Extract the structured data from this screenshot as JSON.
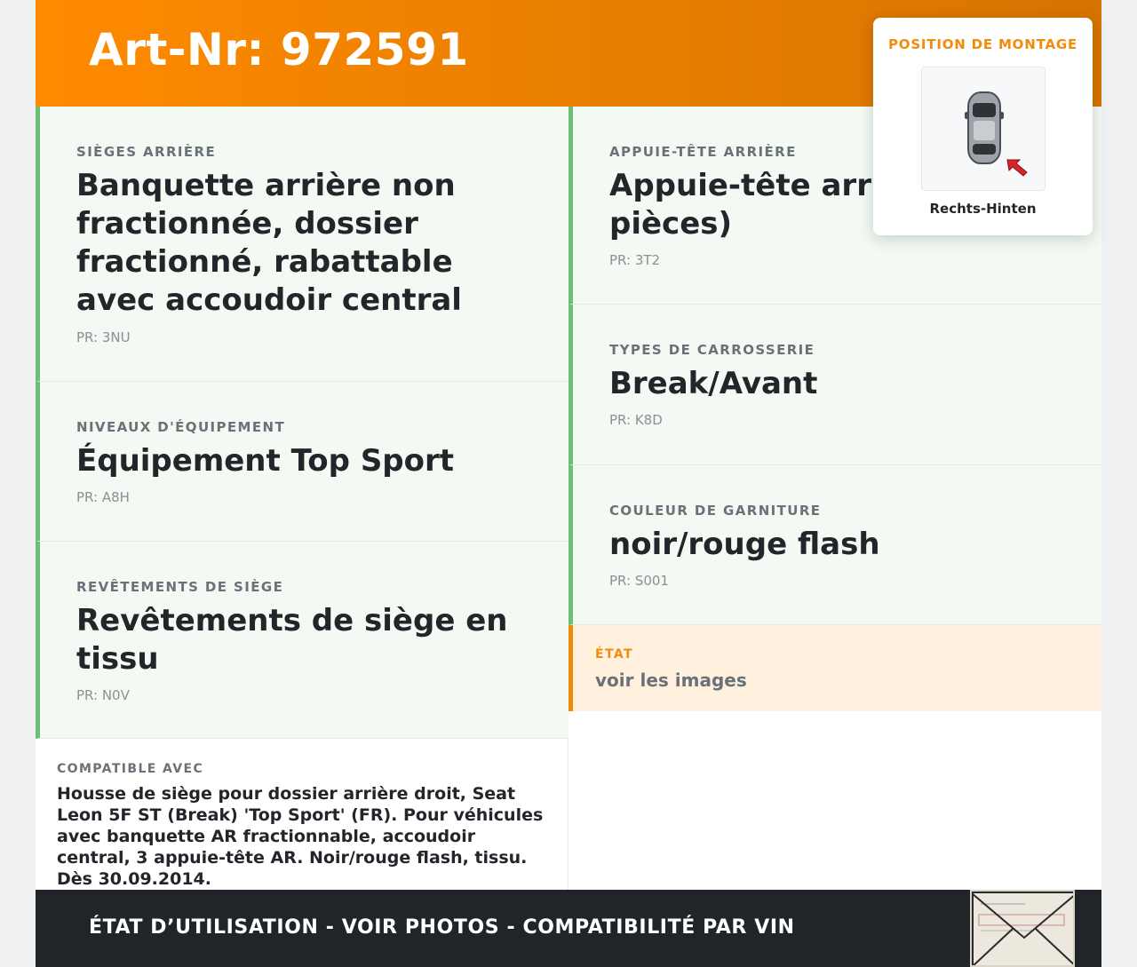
{
  "header": {
    "title": "Art-Nr: 972591"
  },
  "left_cells": [
    {
      "label": "SIÈGES ARRIÈRE",
      "value": "Banquette arrière non fractionnée, dossier fractionné, rabattable avec accoudoir central",
      "pr": "PR: 3NU"
    },
    {
      "label": "NIVEAUX D'ÉQUIPEMENT",
      "value": "Équipement Top Sport",
      "pr": "PR: A8H"
    },
    {
      "label": "REVÊTEMENTS DE SIÈGE",
      "value": "Revêtements de siège en tissu",
      "pr": "PR: N0V"
    }
  ],
  "right_cells": [
    {
      "label": "APPUIE-TÊTE ARRIÈRE",
      "value": "Appuie-tête arrière (3 pièces)",
      "pr": "PR: 3T2"
    },
    {
      "label": "TYPES DE CARROSSERIE",
      "value": "Break/Avant",
      "pr": "PR: K8D"
    },
    {
      "label": "COULEUR DE GARNITURE",
      "value": "noir/rouge flash",
      "pr": "PR: S001"
    }
  ],
  "etat": {
    "label": "ÉTAT",
    "value": "voir les images"
  },
  "compat": {
    "label": "COMPATIBLE AVEC",
    "value": "Housse de siège pour dossier arrière droit, Seat Leon 5F ST (Break) 'Top Sport' (FR). Pour véhicules avec banquette AR fractionnable, accoudoir central, 3 appuie-tête AR. Noir/rouge flash, tissu. Dès 30.09.2014."
  },
  "mounting": {
    "title": "POSITION DE MONTAGE",
    "position": "Rechts-Hinten",
    "icon": "car-top-view-icon"
  },
  "footer": {
    "text": "ÉTAT D’UTILISATION - VOIR PHOTOS - COMPATIBILITÉ PAR VIN"
  },
  "colors": {
    "accent": "#f28b0c",
    "header": "#ff8a00",
    "cell_border": "#6dbf73",
    "footer": "#212429"
  }
}
